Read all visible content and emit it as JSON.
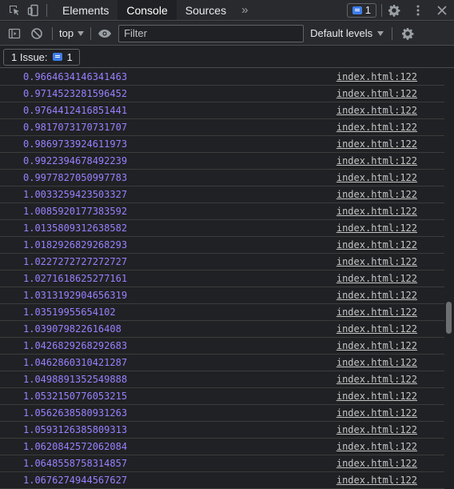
{
  "tabs": [
    "Elements",
    "Console",
    "Sources"
  ],
  "issues_count": "1",
  "context": "top",
  "filter_placeholder": "Filter",
  "levels": "Default levels",
  "issues_bar": {
    "label": "1 Issue:",
    "count": "1"
  },
  "source": "index.html:122",
  "log": [
    "0.9664634146341463",
    "0.9714523281596452",
    "0.9764412416851441",
    "0.9817073170731707",
    "0.9869733924611973",
    "0.9922394678492239",
    "0.9977827050997783",
    "1.0033259423503327",
    "1.0085920177383592",
    "1.0135809312638582",
    "1.0182926829268293",
    "1.0227272727272727",
    "1.0271618625277161",
    "1.0313192904656319",
    "1.03519955654102",
    "1.039079822616408",
    "1.0426829268292683",
    "1.0462860310421287",
    "1.0498891352549888",
    "1.0532150776053215",
    "1.0562638580931263",
    "1.0593126385809313",
    "1.0620842572062084",
    "1.0648558758314857",
    "1.0676274944567627"
  ]
}
